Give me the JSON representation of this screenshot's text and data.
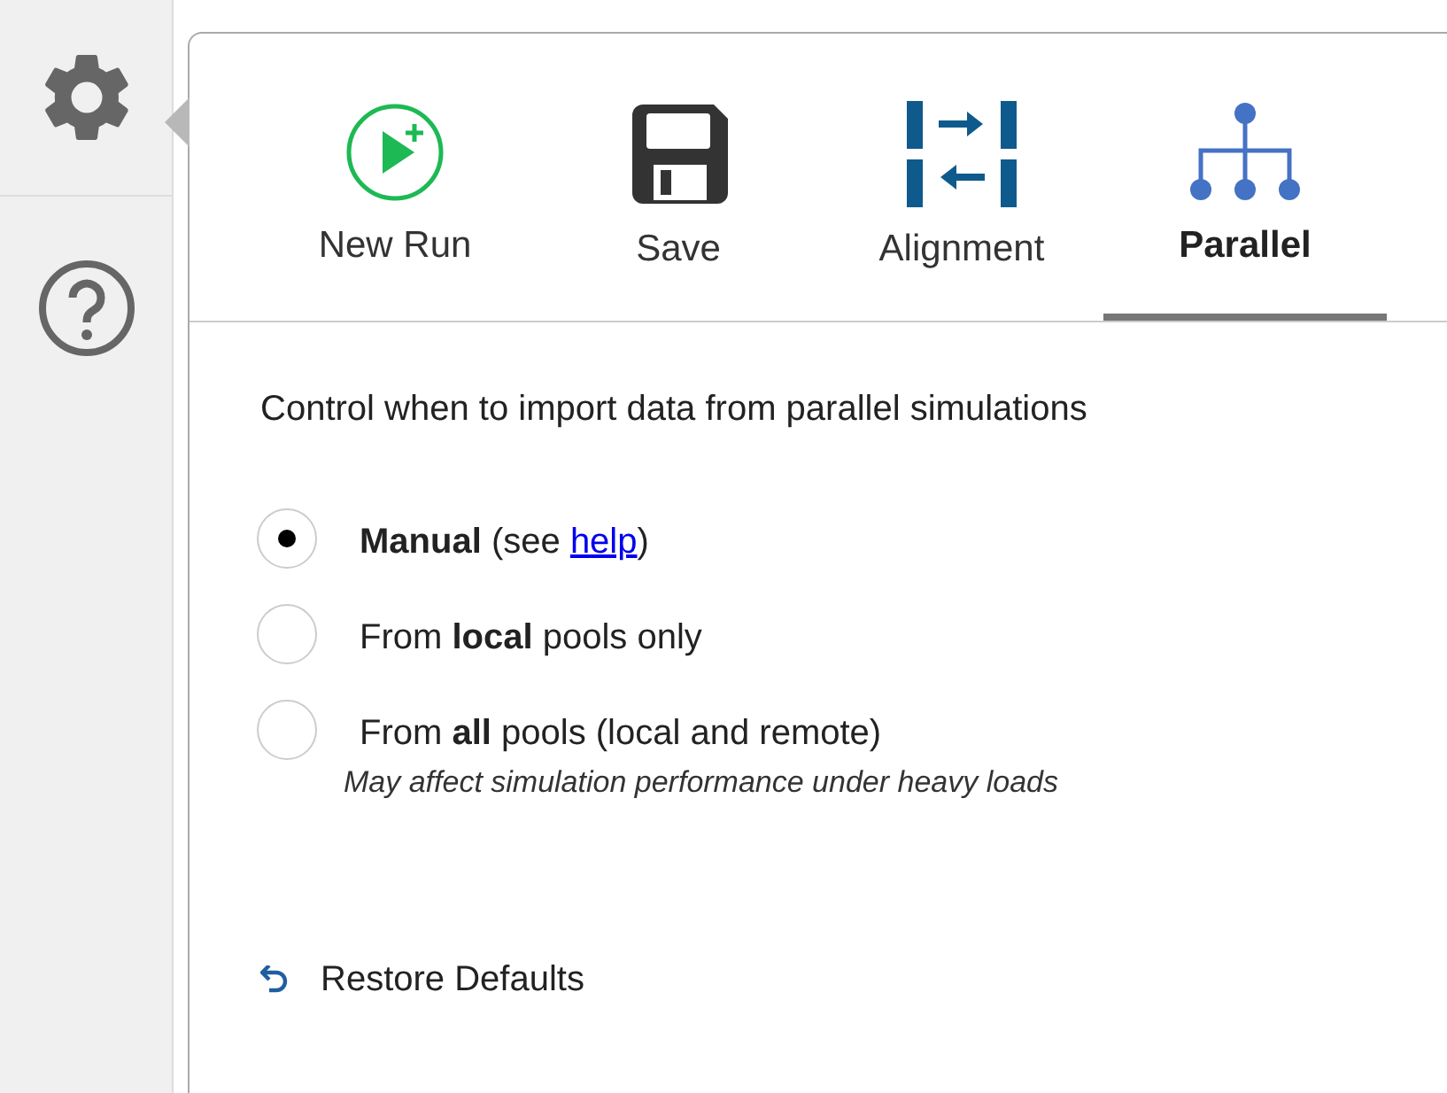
{
  "tabs": [
    {
      "kind": "new-run",
      "label": "New Run",
      "selected": false
    },
    {
      "kind": "save",
      "label": "Save",
      "selected": false
    },
    {
      "kind": "alignment",
      "label": "Alignment",
      "selected": false
    },
    {
      "kind": "parallel",
      "label": "Parallel",
      "selected": true
    }
  ],
  "description": "Control when to import data from parallel simulations",
  "options": [
    {
      "label": "**Manual** (see ",
      "link": "help",
      "label_end": ")",
      "selected": true
    },
    {
      "label": "From **local** pools only",
      "selected": false
    },
    {
      "label": "From **all** pools (local and remote)",
      "note": "May affect simulation performance under heavy loads",
      "selected": false
    }
  ],
  "restore_button": "Restore Defaults"
}
